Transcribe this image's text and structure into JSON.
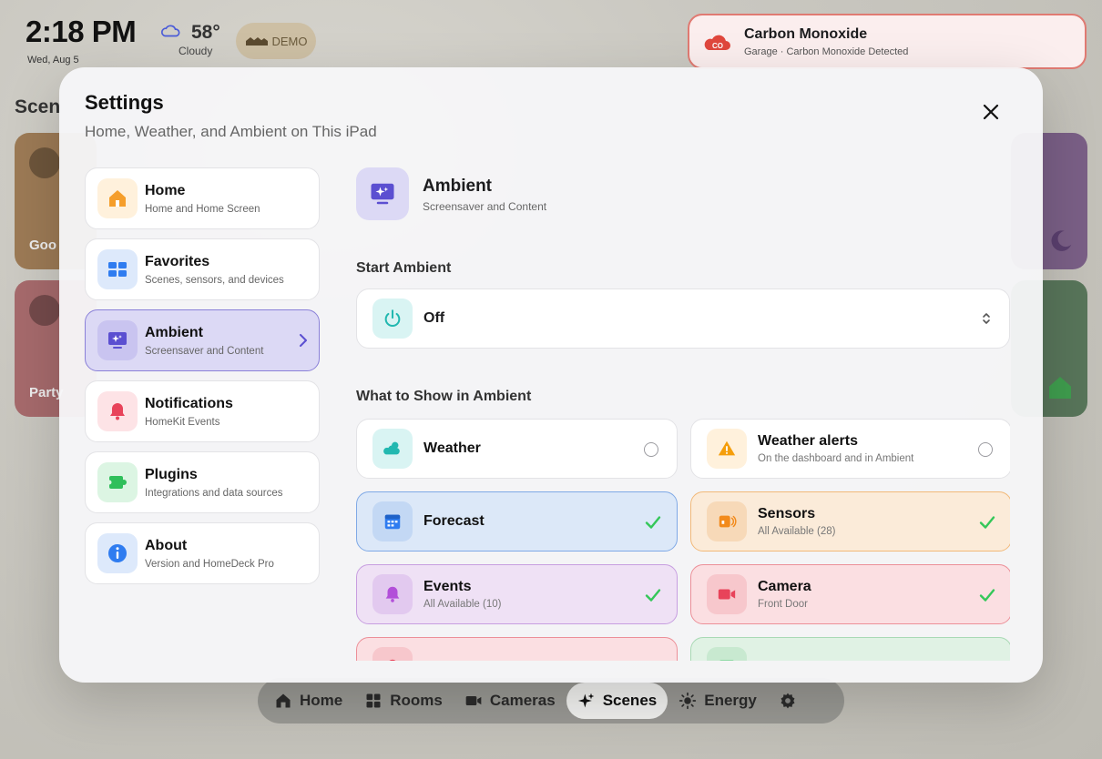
{
  "status_bar": {
    "time": "2:18 PM",
    "date": "Wed, Aug 5",
    "temperature": "58°",
    "condition": "Cloudy",
    "mode_badge": "DEMO",
    "weather_icon": "cloud-icon"
  },
  "background": {
    "scenes_heading": "Scen",
    "scene_cards": [
      {
        "label": "Goo",
        "color": "#9c7a55"
      },
      {
        "label": "Party",
        "color": "#a66a6c"
      }
    ],
    "right_cards": [
      {
        "color": "#7a5f86",
        "icon": "moon-icon"
      },
      {
        "color": "#58755a",
        "icon": "house-icon"
      }
    ]
  },
  "alert": {
    "title": "Carbon Monoxide",
    "subtitle": "Garage · Carbon Monoxide Detected",
    "icon": "co-cloud-icon",
    "color": "#e0473d"
  },
  "tab_bar": {
    "tabs": [
      {
        "label": "Home",
        "icon": "home-icon",
        "active": false
      },
      {
        "label": "Rooms",
        "icon": "grid-icon",
        "active": false
      },
      {
        "label": "Cameras",
        "icon": "video-icon",
        "active": false
      },
      {
        "label": "Scenes",
        "icon": "sparkles-icon",
        "active": true
      },
      {
        "label": "Energy",
        "icon": "sun-icon",
        "active": false
      }
    ],
    "settings_icon": "gear-icon"
  },
  "settings": {
    "title": "Settings",
    "subtitle": "Home, Weather, and Ambient on This iPad",
    "nav": [
      {
        "label": "Home",
        "desc": "Home and Home Screen",
        "icon": "house-icon",
        "icon_bg": "#fff1dc",
        "icon_color": "#f59e2b",
        "active": false
      },
      {
        "label": "Favorites",
        "desc": "Scenes, sensors, and devices",
        "icon": "grid-icon",
        "icon_bg": "#dde9fb",
        "icon_color": "#2f7cf0",
        "active": false
      },
      {
        "label": "Ambient",
        "desc": "Screensaver and Content",
        "icon": "monitor-sparkle-icon",
        "icon_bg": "#c9c4f0",
        "icon_color": "#5b4fd1",
        "active": true
      },
      {
        "label": "Notifications",
        "desc": "HomeKit Events",
        "icon": "bell-icon",
        "icon_bg": "#fde3e6",
        "icon_color": "#e8435a",
        "active": false
      },
      {
        "label": "Plugins",
        "desc": "Integrations and data sources",
        "icon": "plugin-icon",
        "icon_bg": "#dcf5e3",
        "icon_color": "#2fbf5a",
        "active": false
      },
      {
        "label": "About",
        "desc": "Version and HomeDeck Pro",
        "icon": "info-icon",
        "icon_bg": "#dde9fb",
        "icon_color": "#2f7cf0",
        "active": false
      }
    ],
    "panel": {
      "title": "Ambient",
      "subtitle": "Screensaver and Content",
      "start_heading": "Start Ambient",
      "start_value": "Off",
      "show_heading": "What to Show in Ambient",
      "options": [
        {
          "title": "Weather",
          "desc": "",
          "icon": "cloud-sun-icon",
          "bg": "#ffffff",
          "border": "#e3e3e6",
          "icon_bg": "#d9f4f3",
          "icon_color": "#22b8b0",
          "checked": false
        },
        {
          "title": "Weather alerts",
          "desc": "On the dashboard and in Ambient",
          "icon": "warning-icon",
          "bg": "#ffffff",
          "border": "#e3e3e6",
          "icon_bg": "#fff1dc",
          "icon_color": "#f59e0b",
          "checked": false
        },
        {
          "title": "Forecast",
          "desc": "",
          "icon": "calendar-icon",
          "bg": "#dce8f8",
          "border": "#7fa9e6",
          "icon_bg": "#c3d8f4",
          "icon_color": "#2f7cf0",
          "checked": true
        },
        {
          "title": "Sensors",
          "desc": "All Available (28)",
          "icon": "sensor-icon",
          "bg": "#fbebd9",
          "border": "#f2b979",
          "icon_bg": "#f7d9b8",
          "icon_color": "#f28a1b",
          "checked": true
        },
        {
          "title": "Events",
          "desc": "All Available (10)",
          "icon": "bell-icon",
          "bg": "#efe1f5",
          "border": "#c79ee0",
          "icon_bg": "#e2c9ef",
          "icon_color": "#b24fd9",
          "checked": true
        },
        {
          "title": "Camera",
          "desc": "Front Door",
          "icon": "video-icon",
          "bg": "#fbdfe2",
          "border": "#ec8f98",
          "icon_bg": "#f7c7cc",
          "icon_color": "#e8435a",
          "checked": true
        },
        {
          "title": "",
          "desc": "",
          "icon": "bell-icon",
          "bg": "#fbdfe2",
          "border": "#ec8f98",
          "icon_bg": "#f7c7cc",
          "icon_color": "#e8435a",
          "checked": false
        },
        {
          "title": "",
          "desc": "",
          "icon": "grid-icon",
          "bg": "#e0f2e4",
          "border": "#a8d9b4",
          "icon_bg": "#c8e9d0",
          "icon_color": "#2fbf5a",
          "checked": false
        }
      ]
    }
  }
}
